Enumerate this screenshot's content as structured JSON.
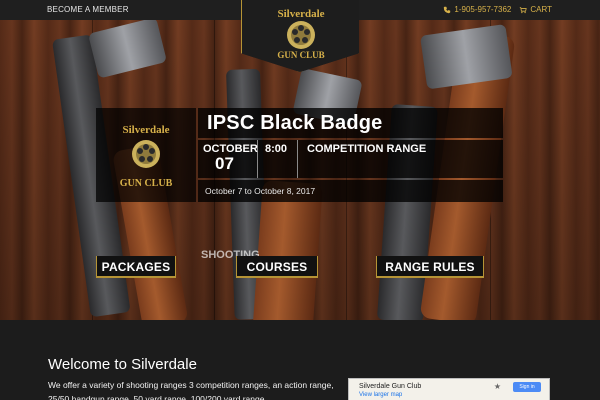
{
  "topbar": {
    "left_link": "BECOME A MEMBER",
    "phone": "1-905-957-7362",
    "cart": "CART"
  },
  "brand": {
    "logo_word_top": "Silverdale",
    "logo_word_bottom": "GUN CLUB"
  },
  "event": {
    "title": "IPSC Black Badge",
    "month": "OCTOBER",
    "day": "07",
    "time": "8:00",
    "venue": "COMPETITION RANGE",
    "date_range": "October 7 to October 8, 2017"
  },
  "hero_buttons": {
    "shooting_peek": "SHOOTING",
    "packages": "PACKAGES",
    "courses": "COURSES",
    "range_rules": "RANGE RULES"
  },
  "welcome": {
    "title": "Welcome to Silverdale",
    "text": "We offer a variety of shooting ranges 3 competition ranges, an action range, 25/50 handgun range, 50 yard range, 100/200 yard range,"
  },
  "map": {
    "title": "Silverdale Gun Club",
    "link": "View larger map",
    "signin": "Sign in"
  },
  "colors": {
    "accent_gold": "#b69435",
    "topbar_bg": "#1f1f1f",
    "section_bg": "#1c1c1c"
  }
}
